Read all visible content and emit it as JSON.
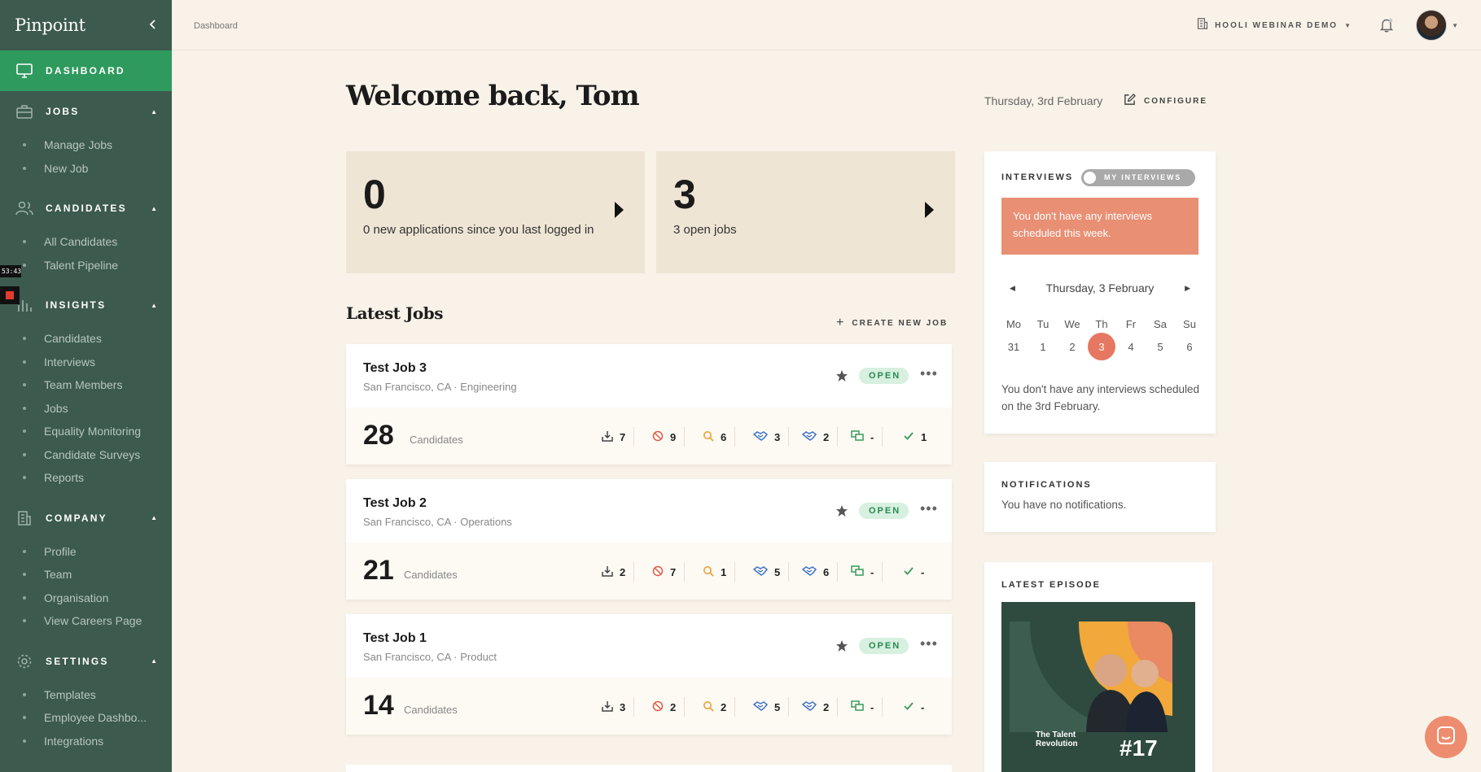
{
  "sidebar": {
    "brand": "Pinpoint",
    "collapse_icon": "chevron-left-icon",
    "sections": [
      {
        "key": "dashboard",
        "label": "DASHBOARD",
        "icon": "monitor-icon",
        "active": true,
        "items": []
      },
      {
        "key": "jobs",
        "label": "JOBS",
        "icon": "briefcase-icon",
        "active": false,
        "items": [
          "Manage Jobs",
          "New Job"
        ]
      },
      {
        "key": "candidates",
        "label": "CANDIDATES",
        "icon": "users-icon",
        "active": false,
        "items": [
          "All Candidates",
          "Talent Pipeline"
        ]
      },
      {
        "key": "insights",
        "label": "INSIGHTS",
        "icon": "bar-chart-icon",
        "active": false,
        "items": [
          "Candidates",
          "Interviews",
          "Team Members",
          "Jobs",
          "Equality Monitoring",
          "Candidate Surveys",
          "Reports"
        ]
      },
      {
        "key": "company",
        "label": "COMPANY",
        "icon": "building-icon",
        "active": false,
        "items": [
          "Profile",
          "Team",
          "Organisation",
          "View Careers Page"
        ]
      },
      {
        "key": "settings",
        "label": "SETTINGS",
        "icon": "gear-icon",
        "active": false,
        "items": [
          "Templates",
          "Employee Dashbo...",
          "Integrations"
        ]
      }
    ],
    "recorder_time": "53:43"
  },
  "topbar": {
    "breadcrumb": "Dashboard",
    "org_name": "HOOLI WEBINAR DEMO",
    "notifications_icon": "bell-icon",
    "avatar_icon": "avatar"
  },
  "main": {
    "welcome": "Welcome back, Tom",
    "date": "Thursday, 3rd February",
    "configure_label": "CONFIGURE",
    "stats": [
      {
        "num": "0",
        "desc": "0 new applications since you last logged in"
      },
      {
        "num": "3",
        "desc": "3 open jobs"
      }
    ],
    "latest_jobs_title": "Latest Jobs",
    "create_job_label": "CREATE NEW JOB",
    "candidates_label": "Candidates",
    "jobs": [
      {
        "title": "Test Job 3",
        "subtitle": "San Francisco, CA · Engineering",
        "status": "OPEN",
        "count": "28",
        "stages": [
          "7",
          "9",
          "6",
          "3",
          "2",
          "-",
          "1"
        ]
      },
      {
        "title": "Test Job 2",
        "subtitle": "San Francisco, CA · Operations",
        "status": "OPEN",
        "count": "21",
        "stages": [
          "2",
          "7",
          "1",
          "5",
          "6",
          "-",
          "-"
        ]
      },
      {
        "title": "Test Job 1",
        "subtitle": "San Francisco, CA · Product",
        "status": "OPEN",
        "count": "14",
        "stages": [
          "3",
          "2",
          "2",
          "5",
          "2",
          "-",
          "-"
        ]
      }
    ],
    "stage_icons": [
      "inbox-icon",
      "rejected-icon",
      "search-icon",
      "handshake-icon",
      "handshake-icon",
      "offer-icon",
      "check-icon"
    ],
    "stage_colors": [
      "#444444",
      "#e05a4a",
      "#e8a33a",
      "#3b73c8",
      "#3b73c8",
      "#3a9a5e",
      "#3a9a5e"
    ]
  },
  "interviews": {
    "title": "INTERVIEWS",
    "toggle_label": "MY INTERVIEWS",
    "alert": "You don't have any interviews scheduled this week.",
    "calendar_title": "Thursday, 3 February",
    "weekdays": [
      "Mo",
      "Tu",
      "We",
      "Th",
      "Fr",
      "Sa",
      "Su"
    ],
    "days": [
      "31",
      "1",
      "2",
      "3",
      "4",
      "5",
      "6"
    ],
    "today": "3",
    "empty_text": "You don't have any interviews scheduled on the 3rd February."
  },
  "notifications": {
    "title": "NOTIFICATIONS",
    "empty_text": "You have no notifications."
  },
  "episode": {
    "title": "LATEST EPISODE",
    "show_name": "The Talent Revolution",
    "number": "#17"
  },
  "colors": {
    "sidebar_bg": "#3d5a4f",
    "active_green": "#2f9a5e",
    "page_bg": "#f8f2e8",
    "alert": "#e98f74",
    "chat": "#ee8c70"
  }
}
